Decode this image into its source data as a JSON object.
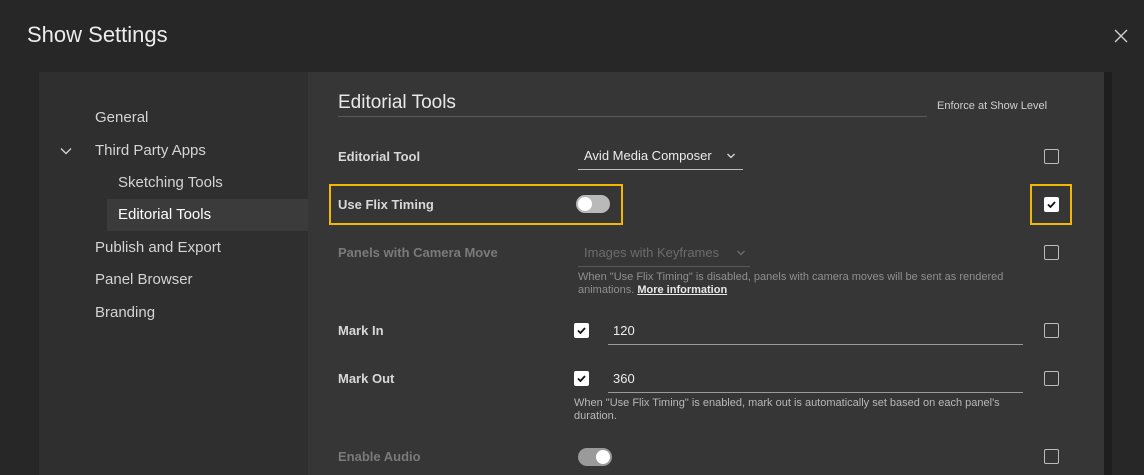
{
  "dialog": {
    "title": "Show Settings"
  },
  "sidebar": {
    "items": [
      {
        "label": "General"
      },
      {
        "label": "Third Party Apps"
      },
      {
        "label": "Sketching Tools"
      },
      {
        "label": "Editorial Tools"
      },
      {
        "label": "Publish and Export"
      },
      {
        "label": "Panel Browser"
      },
      {
        "label": "Branding"
      }
    ]
  },
  "main": {
    "section_title": "Editorial Tools",
    "enforce_header": "Enforce at Show Level",
    "rows": {
      "editorial_tool": {
        "label": "Editorial Tool",
        "value": "Avid Media Composer",
        "enforced": false
      },
      "use_flix_timing": {
        "label": "Use Flix Timing",
        "toggle_on": false,
        "enforced": true
      },
      "panels_camera": {
        "label": "Panels with Camera Move",
        "value": "Images with Keyframes",
        "help_text": "When \"Use Flix Timing\" is disabled, panels with camera moves will be sent as rendered animations.",
        "help_link": "More information",
        "enforced": false
      },
      "mark_in": {
        "label": "Mark In",
        "checked": true,
        "value": "120",
        "enforced": false
      },
      "mark_out": {
        "label": "Mark Out",
        "checked": true,
        "value": "360",
        "help_text": "When \"Use Flix Timing\" is enabled, mark out is automatically set based on each panel's duration.",
        "enforced": false
      },
      "enable_audio": {
        "label": "Enable Audio",
        "toggle_on": true,
        "enforced": false
      }
    }
  },
  "colors": {
    "highlight": "#f2b705",
    "background": "#272727",
    "panel": "#363636"
  }
}
